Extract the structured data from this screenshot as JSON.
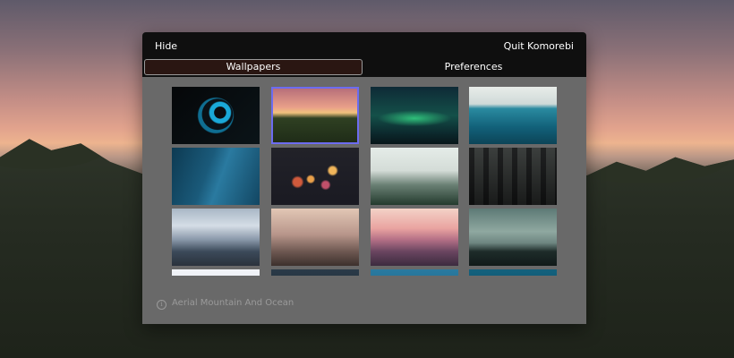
{
  "header": {
    "hide_label": "Hide",
    "quit_label": "Quit Komorebi"
  },
  "tabs": [
    {
      "label": "Wallpapers",
      "active": true
    },
    {
      "label": "Preferences",
      "active": false
    }
  ],
  "wallpapers": [
    {
      "name": "light-spiral"
    },
    {
      "name": "aerial-mountain-and-ocean",
      "selected": true
    },
    {
      "name": "aurora"
    },
    {
      "name": "underwater"
    },
    {
      "name": "water-surface"
    },
    {
      "name": "bokeh-lights"
    },
    {
      "name": "foggy-forest"
    },
    {
      "name": "forest-trees"
    },
    {
      "name": "matterhorn"
    },
    {
      "name": "misty-dock"
    },
    {
      "name": "pink-mountains"
    },
    {
      "name": "teal-landscape"
    }
  ],
  "info": {
    "icon": "info-icon",
    "selected_name": "Aerial Mountain And Ocean"
  },
  "colors": {
    "selection": "#6c6cf0",
    "panel": "#696969",
    "bar": "#0f0f0f"
  }
}
